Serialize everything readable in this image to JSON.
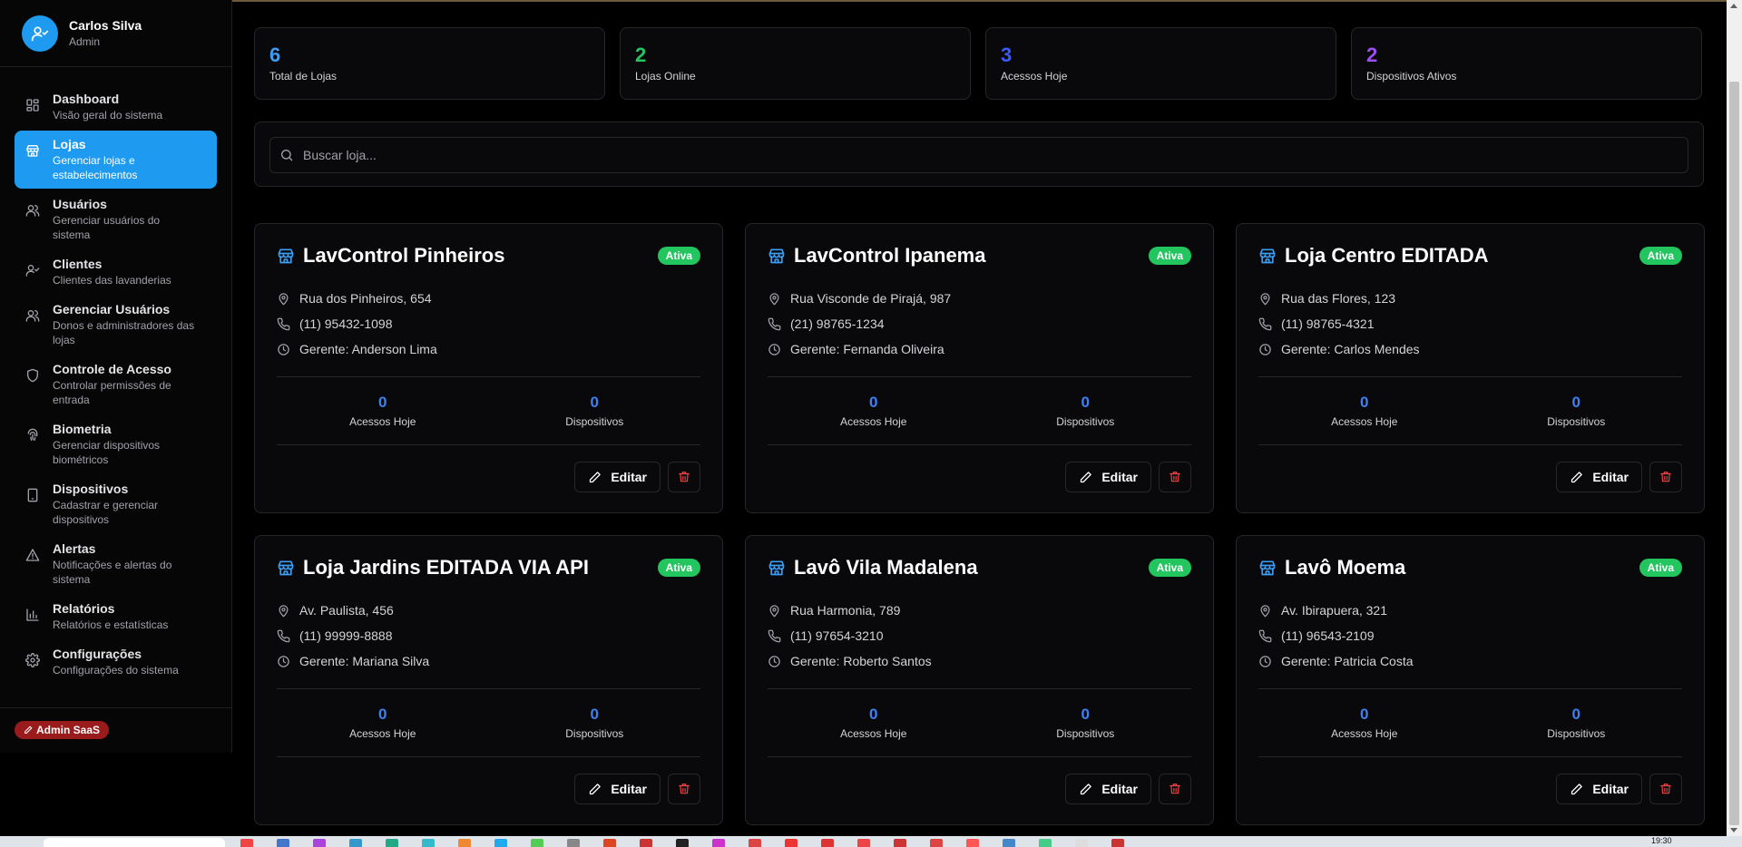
{
  "user": {
    "name": "Carlos Silva",
    "role": "Admin"
  },
  "nav": [
    {
      "label": "Dashboard",
      "sub": "Visão geral do sistema",
      "icon": "grid-icon",
      "active": false
    },
    {
      "label": "Lojas",
      "sub": "Gerenciar lojas e estabelecimentos",
      "icon": "store-icon",
      "active": true
    },
    {
      "label": "Usuários",
      "sub": "Gerenciar usuários do sistema",
      "icon": "users-icon",
      "active": false
    },
    {
      "label": "Clientes",
      "sub": "Clientes das lavanderias",
      "icon": "user-check-icon",
      "active": false
    },
    {
      "label": "Gerenciar Usuários",
      "sub": "Donos e administradores das lojas",
      "icon": "users-icon",
      "active": false
    },
    {
      "label": "Controle de Acesso",
      "sub": "Controlar permissões de entrada",
      "icon": "shield-icon",
      "active": false
    },
    {
      "label": "Biometria",
      "sub": "Gerenciar dispositivos biométricos",
      "icon": "fingerprint-icon",
      "active": false
    },
    {
      "label": "Dispositivos",
      "sub": "Cadastrar e gerenciar dispositivos",
      "icon": "tablet-icon",
      "active": false
    },
    {
      "label": "Alertas",
      "sub": "Notificações e alertas do sistema",
      "icon": "alert-triangle-icon",
      "active": false
    },
    {
      "label": "Relatórios",
      "sub": "Relatórios e estatísticas",
      "icon": "bar-chart-icon",
      "active": false
    },
    {
      "label": "Configurações",
      "sub": "Configurações do sistema",
      "icon": "gear-icon",
      "active": false
    }
  ],
  "footer_badge": "Admin SaaS",
  "stats": [
    {
      "value": "6",
      "label": "Total de Lojas",
      "color": "#3b9ef5"
    },
    {
      "value": "2",
      "label": "Lojas Online",
      "color": "#22c55e"
    },
    {
      "value": "3",
      "label": "Acessos Hoje",
      "color": "#3b5bf5"
    },
    {
      "value": "2",
      "label": "Dispositivos Ativos",
      "color": "#9d4ef5"
    }
  ],
  "search": {
    "placeholder": "Buscar loja..."
  },
  "labels": {
    "acessos": "Acessos Hoje",
    "dispositivos": "Dispositivos",
    "edit": "Editar"
  },
  "stores": [
    {
      "name": "LavControl Pinheiros",
      "status": "Ativa",
      "address": "Rua dos Pinheiros, 654",
      "phone": "(11) 95432-1098",
      "manager": "Gerente: Anderson Lima",
      "acessos": "0",
      "dispositivos": "0"
    },
    {
      "name": "LavControl Ipanema",
      "status": "Ativa",
      "address": "Rua Visconde de Pirajá, 987",
      "phone": "(21) 98765-1234",
      "manager": "Gerente: Fernanda Oliveira",
      "acessos": "0",
      "dispositivos": "0"
    },
    {
      "name": "Loja Centro EDITADA",
      "status": "Ativa",
      "address": "Rua das Flores, 123",
      "phone": "(11) 98765-4321",
      "manager": "Gerente: Carlos Mendes",
      "acessos": "0",
      "dispositivos": "0"
    },
    {
      "name": "Loja Jardins EDITADA VIA API",
      "status": "Ativa",
      "address": "Av. Paulista, 456",
      "phone": "(11) 99999-8888",
      "manager": "Gerente: Mariana Silva",
      "acessos": "0",
      "dispositivos": "0"
    },
    {
      "name": "Lavô Vila Madalena",
      "status": "Ativa",
      "address": "Rua Harmonia, 789",
      "phone": "(11) 97654-3210",
      "manager": "Gerente: Roberto Santos",
      "acessos": "0",
      "dispositivos": "0"
    },
    {
      "name": "Lavô Moema",
      "status": "Ativa",
      "address": "Av. Ibirapuera, 321",
      "phone": "(11) 96543-2109",
      "manager": "Gerente: Patricia Costa",
      "acessos": "0",
      "dispositivos": "0"
    }
  ],
  "taskbar": {
    "clock": "19:30"
  }
}
